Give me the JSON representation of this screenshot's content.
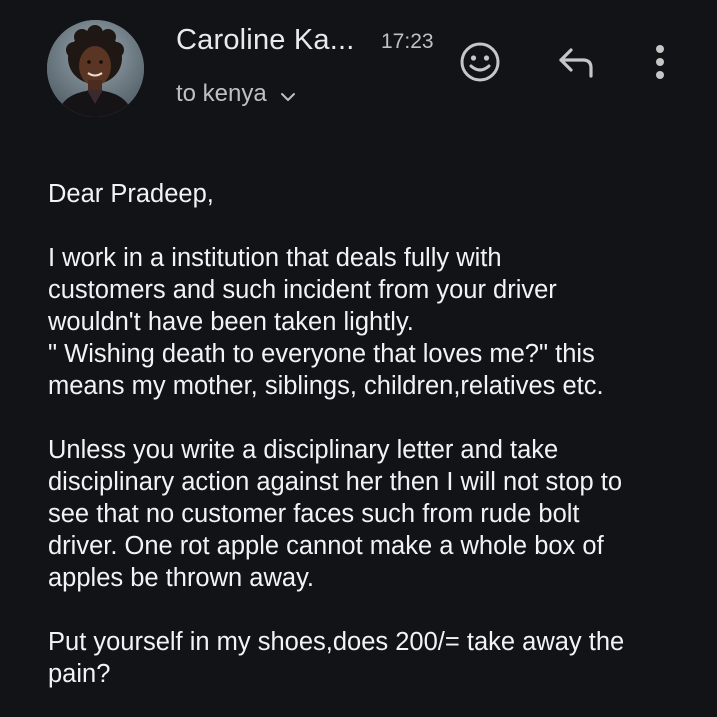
{
  "header": {
    "sender_name": "Caroline Ka...",
    "time": "17:23",
    "recipient": "to kenya",
    "icons": {
      "emoji": "add-reaction-icon",
      "reply": "reply-icon",
      "more": "more-vertical-icon",
      "chevron": "chevron-down-icon"
    }
  },
  "message": {
    "greeting": "Dear Pradeep,",
    "paragraph1": [
      "I work in a institution that deals fully with",
      "customers and such incident from your driver",
      "wouldn't have been taken lightly.",
      "\" Wishing death to everyone that loves me?\" this",
      "means my mother, siblings, children,relatives etc."
    ],
    "paragraph2": [
      "Unless you write a disciplinary letter and take",
      "disciplinary action against her then I will not stop to",
      "see that no customer faces such from rude bolt",
      "driver. One rot apple cannot make a whole box of",
      "apples be thrown away."
    ],
    "paragraph3": [
      "Put yourself in my shoes,does 200/= take away the",
      "pain?"
    ]
  },
  "colors": {
    "background": "#121317",
    "text": "#f1f3f4",
    "secondary_text": "#bdc1c6",
    "icon": "#c4c7c5"
  }
}
